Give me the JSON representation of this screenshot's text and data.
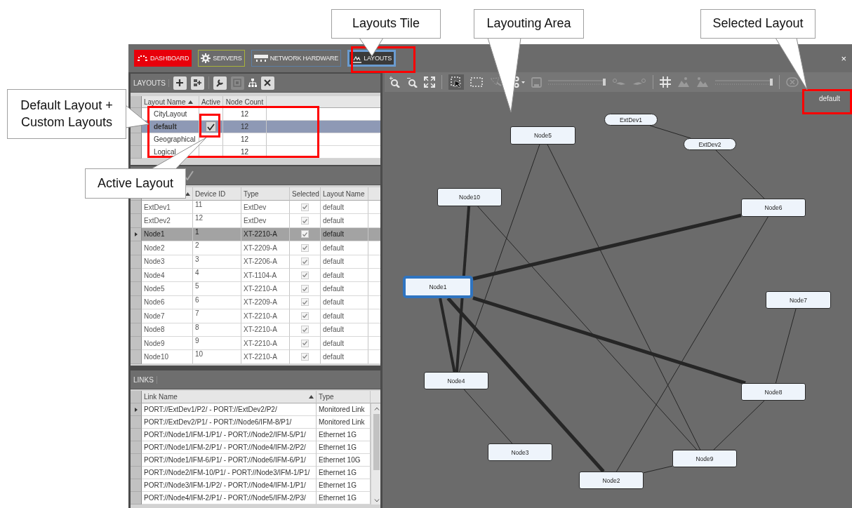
{
  "tabs": [
    {
      "label": "DASHBOARD",
      "kind": "solid",
      "color": "#e8000b",
      "selected": false
    },
    {
      "label": "SERVERS",
      "kind": "outline",
      "color": "#a9b23a",
      "selected": false
    },
    {
      "label": "NETWORK HARDWARE",
      "kind": "outline",
      "color": "#5c7fa6",
      "selected": false
    },
    {
      "label": "LAYOUTS",
      "kind": "outline",
      "color": "#6a9bd0",
      "selected": true
    }
  ],
  "close_button": "×",
  "layouts": {
    "title": "LAYOUTS",
    "columns": [
      "Layout Name",
      "Active",
      "Node Count"
    ],
    "rows": [
      {
        "name": "CityLayout",
        "active": false,
        "node_count": "12",
        "selected": false
      },
      {
        "name": "default",
        "active": true,
        "node_count": "12",
        "selected": true
      },
      {
        "name": "Geographical",
        "active": false,
        "node_count": "12",
        "selected": false
      },
      {
        "name": "Logical",
        "active": false,
        "node_count": "12",
        "selected": false
      }
    ]
  },
  "devices": {
    "columns": [
      "Device ID",
      "Type",
      "Selected",
      "Layout Name"
    ],
    "rows": [
      {
        "name": "ExtDev1",
        "device_id": "11",
        "type": "ExtDev",
        "checked": true,
        "layout_name": "default",
        "selected": false
      },
      {
        "name": "ExtDev2",
        "device_id": "12",
        "type": "ExtDev",
        "checked": true,
        "layout_name": "default",
        "selected": false
      },
      {
        "name": "Node1",
        "device_id": "1",
        "type": "XT-2210-A",
        "checked": true,
        "layout_name": "default",
        "selected": true
      },
      {
        "name": "Node2",
        "device_id": "2",
        "type": "XT-2209-A",
        "checked": true,
        "layout_name": "default",
        "selected": false
      },
      {
        "name": "Node3",
        "device_id": "3",
        "type": "XT-2206-A",
        "checked": true,
        "layout_name": "default",
        "selected": false
      },
      {
        "name": "Node4",
        "device_id": "4",
        "type": "XT-1104-A",
        "checked": true,
        "layout_name": "default",
        "selected": false
      },
      {
        "name": "Node5",
        "device_id": "5",
        "type": "XT-2210-A",
        "checked": true,
        "layout_name": "default",
        "selected": false
      },
      {
        "name": "Node6",
        "device_id": "6",
        "type": "XT-2209-A",
        "checked": true,
        "layout_name": "default",
        "selected": false
      },
      {
        "name": "Node7",
        "device_id": "7",
        "type": "XT-2210-A",
        "checked": true,
        "layout_name": "default",
        "selected": false
      },
      {
        "name": "Node8",
        "device_id": "8",
        "type": "XT-2210-A",
        "checked": true,
        "layout_name": "default",
        "selected": false
      },
      {
        "name": "Node9",
        "device_id": "9",
        "type": "XT-2210-A",
        "checked": true,
        "layout_name": "default",
        "selected": false
      },
      {
        "name": "Node10",
        "device_id": "10",
        "type": "XT-2210-A",
        "checked": true,
        "layout_name": "default",
        "selected": false
      }
    ]
  },
  "links": {
    "title": "LINKS",
    "columns": [
      "Link Name",
      "Type"
    ],
    "rows": [
      {
        "name": "PORT://ExtDev1/P2/ - PORT://ExtDev2/P2/",
        "type": "Monitored Link",
        "selected": true
      },
      {
        "name": "PORT://ExtDev2/P1/ - PORT://Node6/IFM-8/P1/",
        "type": "Monitored Link",
        "selected": false
      },
      {
        "name": "PORT://Node1/IFM-1/P1/ - PORT://Node2/IFM-5/P1/",
        "type": "Ethernet 1G",
        "selected": false
      },
      {
        "name": "PORT://Node1/IFM-2/P1/ - PORT://Node4/IFM-2/P2/",
        "type": "Ethernet 1G",
        "selected": false
      },
      {
        "name": "PORT://Node1/IFM-6/P1/ - PORT://Node6/IFM-6/P1/",
        "type": "Ethernet 10G",
        "selected": false
      },
      {
        "name": "PORT://Node2/IFM-10/P1/ - PORT://Node3/IFM-1/P1/",
        "type": "Ethernet 1G",
        "selected": false
      },
      {
        "name": "PORT://Node3/IFM-1/P2/ - PORT://Node4/IFM-1/P1/",
        "type": "Ethernet 1G",
        "selected": false
      },
      {
        "name": "PORT://Node4/IFM-2/P1/ - PORT://Node5/IFM-2/P3/",
        "type": "Ethernet 1G",
        "selected": false
      }
    ]
  },
  "canvas": {
    "sliders": [
      {
        "level": 1
      },
      {
        "level": 1
      }
    ],
    "selected_layout": "default",
    "nodes": [
      {
        "label": "ExtDev1",
        "kind": "external",
        "selected": false
      },
      {
        "label": "Node5",
        "kind": "node",
        "selected": false
      },
      {
        "label": "ExtDev2",
        "kind": "external",
        "selected": false
      },
      {
        "label": "Node10",
        "kind": "node",
        "selected": false
      },
      {
        "label": "Node6",
        "kind": "node",
        "selected": false
      },
      {
        "label": "Node1",
        "kind": "node",
        "selected": true
      },
      {
        "label": "Node7",
        "kind": "node",
        "selected": false
      },
      {
        "label": "Node4",
        "kind": "node",
        "selected": false
      },
      {
        "label": "Node8",
        "kind": "node",
        "selected": false
      },
      {
        "label": "Node3",
        "kind": "node",
        "selected": false
      },
      {
        "label": "Node9",
        "kind": "node",
        "selected": false
      },
      {
        "label": "Node2",
        "kind": "node",
        "selected": false
      }
    ]
  },
  "callouts": [
    "Layouts Tile",
    "Layouting Area",
    "Selected Layout",
    "Default Layout + Custom Layouts",
    "Active Layout"
  ]
}
